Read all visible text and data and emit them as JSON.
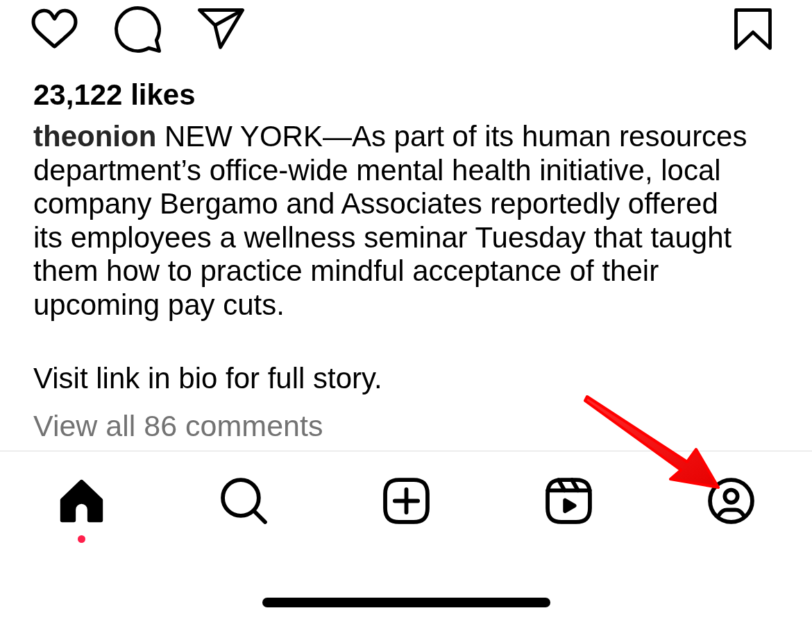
{
  "post_actions": {
    "liked": false,
    "saved": false
  },
  "likes": "23,122 likes",
  "caption": {
    "paragraphs": [
      "**theonion** NEW YORK—As part of its human resources department’s office-wide mental health initiative, local company Bergamo and Associates reportedly offered its employees a wellness seminar Tuesday that taught them how to practice mindful acceptance of their upcoming pay cuts.",
      "Visit link in bio for full story."
    ]
  },
  "view_comments": "View all 86 comments",
  "tab_bar": {
    "items": [
      {
        "kind": "home",
        "selected": true,
        "badge": true,
        "color": "#ff1f4b"
      },
      {
        "kind": "search",
        "selected": false,
        "badge": false
      },
      {
        "kind": "create",
        "selected": false,
        "badge": false
      },
      {
        "kind": "reels",
        "selected": false,
        "badge": false
      },
      {
        "kind": "profile",
        "selected": false,
        "badge": false
      }
    ]
  },
  "annotation": {
    "kind": "arrow"
  }
}
